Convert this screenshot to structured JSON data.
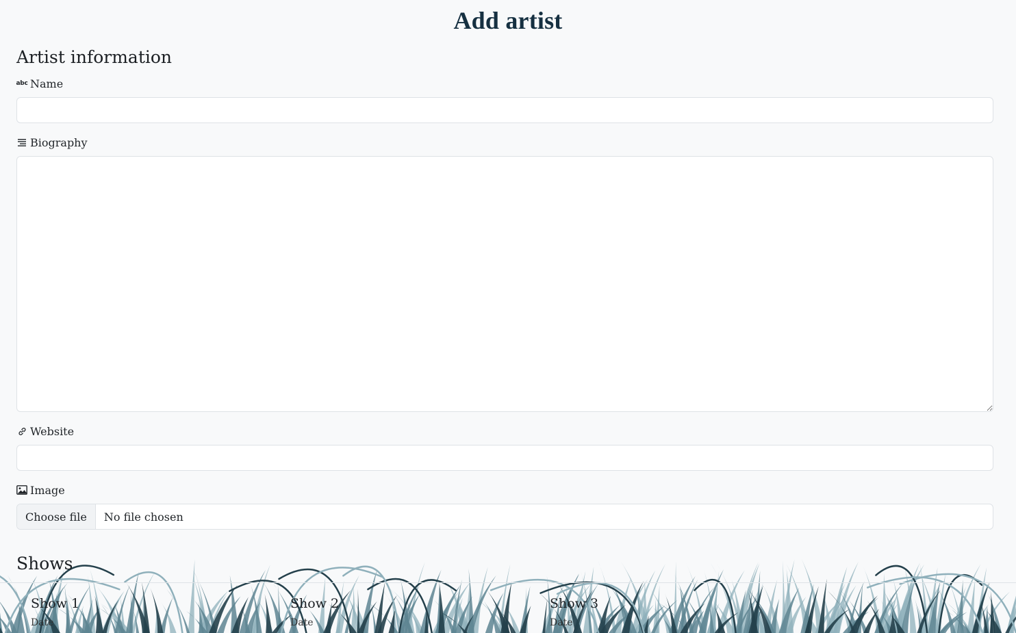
{
  "page": {
    "title": "Add artist"
  },
  "artist_info": {
    "heading": "Artist information",
    "name": {
      "label": "Name",
      "icon": "abc-icon",
      "icon_text": "abc",
      "value": ""
    },
    "biography": {
      "label": "Biography",
      "icon": "text-lines-icon",
      "value": ""
    },
    "website": {
      "label": "Website",
      "icon": "link-icon",
      "value": ""
    },
    "image": {
      "label": "Image",
      "icon": "image-icon",
      "button_label": "Choose file",
      "status": "No file chosen"
    }
  },
  "shows": {
    "heading": "Shows",
    "items": [
      {
        "title": "Show 1",
        "subtitle": "Date"
      },
      {
        "title": "Show 2",
        "subtitle": "Date"
      },
      {
        "title": "Show 3",
        "subtitle": "Date"
      }
    ]
  },
  "colors": {
    "background": "#f8f9fa",
    "title": "#163041",
    "grass_light": "#8fb0bb",
    "grass_mid": "#5e8592",
    "grass_dark": "#24404b"
  }
}
